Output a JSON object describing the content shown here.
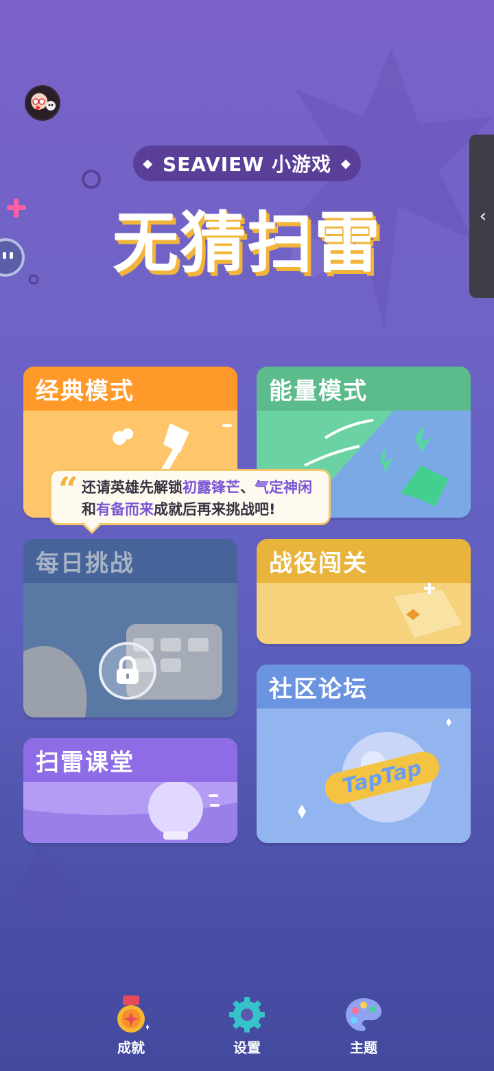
{
  "header": {
    "brand_pill": "SEAVIEW 小游戏",
    "pill_left_glyph": "◆",
    "pill_right_glyph": "◆",
    "title": "无猜扫雷",
    "avatar_icon": "avatar-girl",
    "side_tab_icon": "chevron-left-icon",
    "side_tab_glyph": "‹"
  },
  "modes": {
    "classic": "经典模式",
    "energy": "能量模式",
    "daily": "每日挑战",
    "campaign": "战役闯关",
    "forum": "社区论坛",
    "classroom": "扫雷课堂"
  },
  "forum_badge_text": "TapTap",
  "tooltip": {
    "quote_glyph": "“",
    "part1": "还请英雄先解锁",
    "ach1": "初露锋芒",
    "sep": "、",
    "ach2": "气定神闲",
    "and": "和",
    "ach3": "有备而来",
    "part2": "成就后再来挑战吧!"
  },
  "nav": {
    "achievements": "成就",
    "settings": "设置",
    "theme": "主题"
  },
  "colors": {
    "accent_yellow": "#f2b53b",
    "highlight_purple": "#7a56d4"
  }
}
